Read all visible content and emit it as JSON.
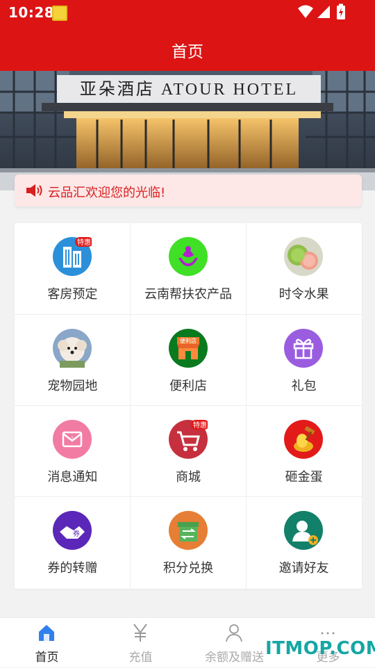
{
  "status_bar": {
    "time": "10:28",
    "app_icon": "app-notification-icon",
    "icons": [
      "wifi-icon",
      "signal-icon",
      "battery-charging-icon"
    ]
  },
  "header": {
    "title": "首页"
  },
  "banner": {
    "sign_text": "亚朵酒店 ATOUR HOTEL"
  },
  "notice": {
    "icon": "speaker-icon",
    "text": "云品汇欢迎您的光临!"
  },
  "menu": {
    "items": [
      {
        "label": "客房预定",
        "icon": "hotel-room-icon",
        "badge": "特惠"
      },
      {
        "label": "云南帮扶农产品",
        "icon": "farm-products-icon"
      },
      {
        "label": "时令水果",
        "icon": "fruit-icon"
      },
      {
        "label": "宠物园地",
        "icon": "pet-icon"
      },
      {
        "label": "便利店",
        "icon": "convenience-store-icon",
        "shop_text": "便利店"
      },
      {
        "label": "礼包",
        "icon": "gift-icon"
      },
      {
        "label": "消息通知",
        "icon": "message-icon"
      },
      {
        "label": "商城",
        "icon": "shopping-cart-icon",
        "badge": "特惠"
      },
      {
        "label": "砸金蛋",
        "icon": "golden-egg-icon"
      },
      {
        "label": "券的转赠",
        "icon": "coupon-transfer-icon",
        "coupon_text": "券"
      },
      {
        "label": "积分兑换",
        "icon": "points-exchange-icon"
      },
      {
        "label": "邀请好友",
        "icon": "invite-friend-icon"
      }
    ]
  },
  "tabbar": {
    "tabs": [
      {
        "label": "首页",
        "icon": "home-icon",
        "active": true
      },
      {
        "label": "充值",
        "icon": "yen-icon",
        "active": false
      },
      {
        "label": "余额及赠送",
        "icon": "user-icon",
        "active": false
      },
      {
        "label": "更多",
        "icon": "more-icon",
        "active": false
      }
    ]
  },
  "watermark": {
    "text": "ITMOP.COM"
  },
  "colors": {
    "primary": "#dc1414",
    "notice_bg": "#fde7e7",
    "notice_text": "#d82020",
    "watermark": "#16a6a4"
  }
}
